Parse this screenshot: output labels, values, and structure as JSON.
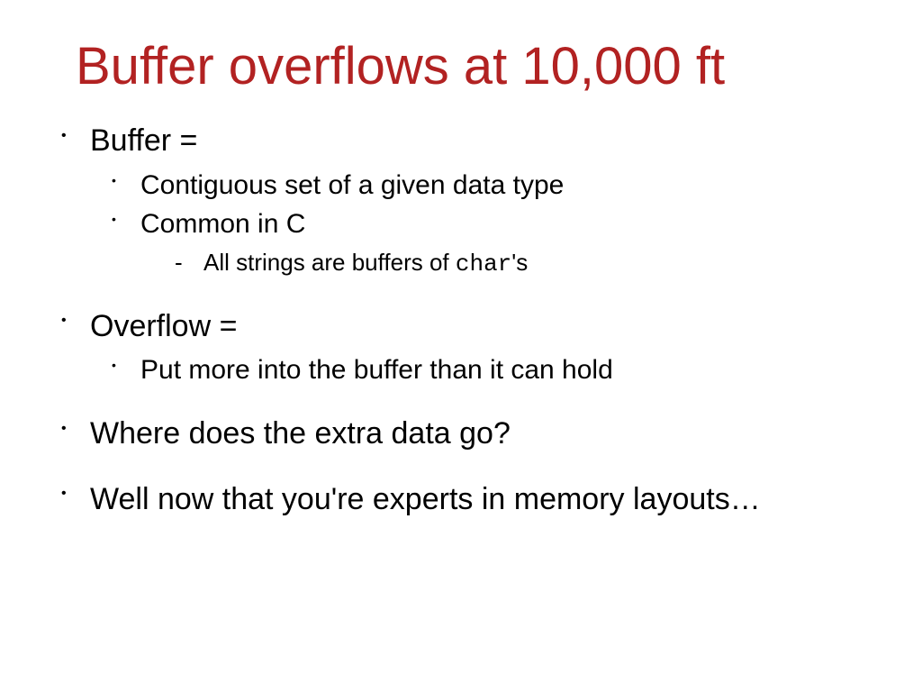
{
  "title": "Buffer overflows at 10,000 ft",
  "bullets": {
    "b1": {
      "label": "Buffer =",
      "sub": {
        "s1": "Contiguous set of a given data type",
        "s2": "Common in C",
        "s2_sub": {
          "prefix": "All strings are buffers of ",
          "code": "char",
          "suffix": "'s"
        }
      }
    },
    "b2": {
      "label": "Overflow =",
      "sub": {
        "s1": "Put more into the buffer than it can hold"
      }
    },
    "b3": {
      "label": "Where does the extra data go?"
    },
    "b4": {
      "label": "Well now that you're experts in memory layouts…"
    }
  }
}
